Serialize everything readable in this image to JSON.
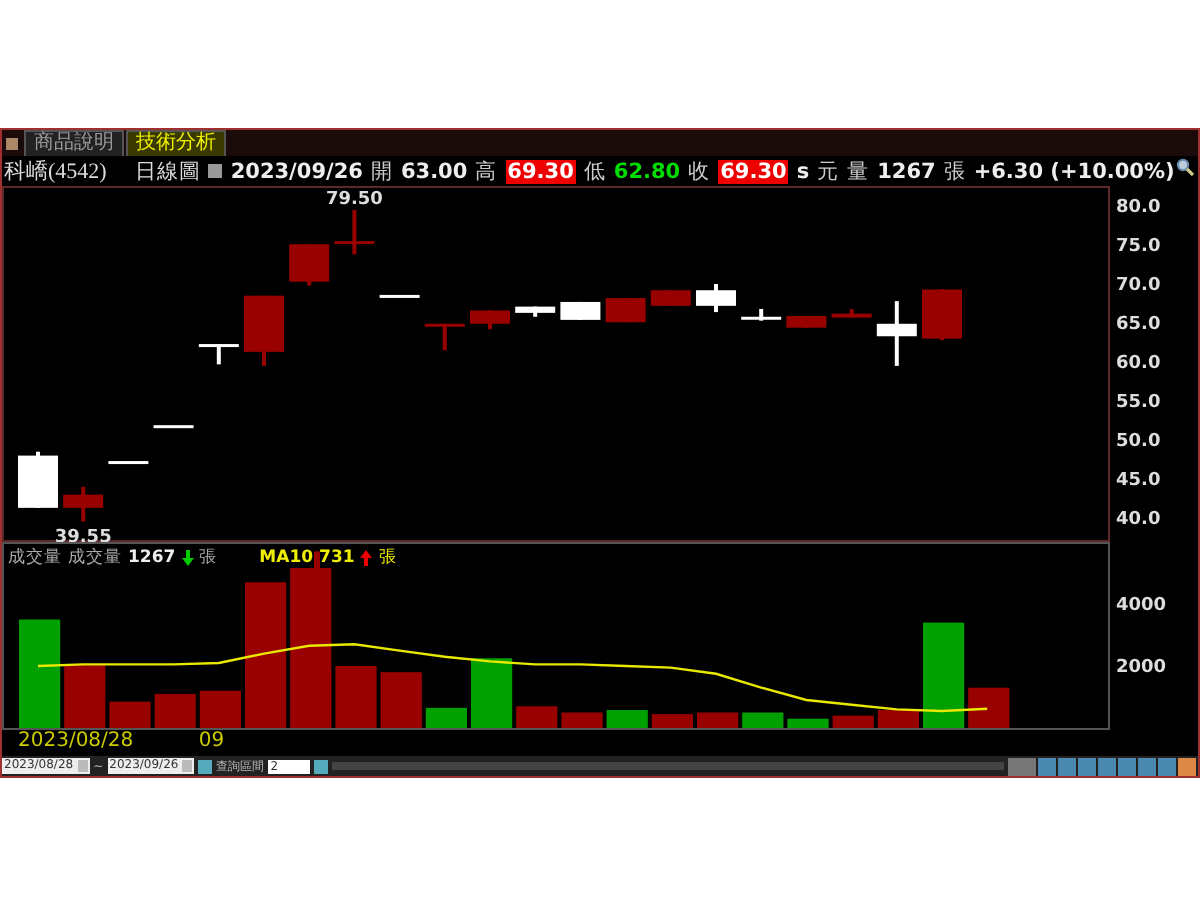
{
  "tabs": [
    {
      "label": "商品說明",
      "selected": false
    },
    {
      "label": "技術分析",
      "selected": true
    }
  ],
  "header": {
    "name": "科嶠(4542)",
    "chart_kind": "日線圖",
    "date": "2023/09/26",
    "open_label": "開",
    "open": "63.00",
    "high_label": "高",
    "high": "69.30",
    "low_label": "低",
    "low": "62.80",
    "close_label": "收",
    "close": "69.30",
    "unit_s": "s",
    "unit": "元",
    "volume_label": "量",
    "volume": "1267",
    "volume_unit": "張",
    "change": "+6.30 (+10.00%)"
  },
  "price_chart": {
    "axis_labels": [
      "80.0",
      "75.0",
      "70.0",
      "65.0",
      "60.0",
      "55.0",
      "50.0",
      "45.0",
      "40.0"
    ],
    "high_marker": "79.50",
    "low_marker": "39.55"
  },
  "volume_chart": {
    "title": "成交量",
    "volume_label": "成交量",
    "volume": "1267",
    "volume_unit": "張",
    "ma_label": "MA10",
    "ma": "731",
    "ma_unit": "張",
    "axis_labels": [
      "4000",
      "2000"
    ]
  },
  "dates": [
    "2023/08/28",
    "09"
  ],
  "toolbar": {
    "from": "2023/08/28",
    "separator": "~",
    "to": "2023/09/26",
    "period_label": "查詢區間",
    "period": "2"
  }
}
